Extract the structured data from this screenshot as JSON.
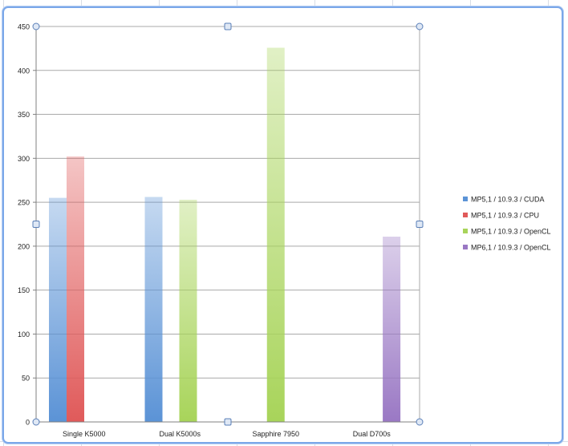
{
  "chart_data": {
    "type": "bar",
    "categories": [
      "Single K5000",
      "Dual K5000s",
      "Sapphire 7950",
      "Dual D700s"
    ],
    "series": [
      {
        "name": "MP5,1 / 10.9.3 / CUDA",
        "color": "#5b93d6",
        "values": [
          255,
          256,
          null,
          null
        ]
      },
      {
        "name": "MP5,1 / 10.9.3 / CPU",
        "color": "#e05a5a",
        "values": [
          302,
          null,
          null,
          null
        ]
      },
      {
        "name": "MP5,1 / 10.9.3 / OpenCL",
        "color": "#a8d45a",
        "values": [
          null,
          253,
          426,
          null
        ]
      },
      {
        "name": "MP6,1 / 10.9.3 / OpenCL",
        "color": "#9a78c4",
        "values": [
          null,
          null,
          null,
          211
        ]
      }
    ],
    "ylim": [
      0,
      450
    ],
    "yticks": [
      "0",
      "50",
      "100",
      "150",
      "200",
      "250",
      "300",
      "350",
      "400",
      "450"
    ],
    "grid": true,
    "legend_position": "right"
  }
}
